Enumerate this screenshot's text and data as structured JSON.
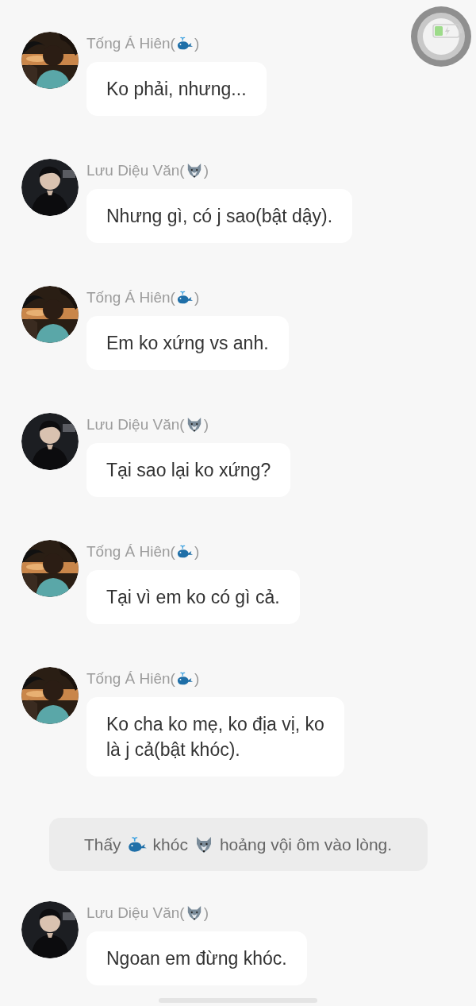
{
  "messages": [
    {
      "kind": "chat",
      "name_parts": [
        {
          "kind": "text",
          "text": "Tống Á Hiên("
        },
        {
          "kind": "whale"
        },
        {
          "kind": "text",
          "text": ")"
        }
      ],
      "text": "Ko phải, nhưng..."
    },
    {
      "kind": "chat",
      "name_parts": [
        {
          "kind": "text",
          "text": "Lưu Diệu Văn("
        },
        {
          "kind": "wolf"
        },
        {
          "kind": "text",
          "text": ")"
        }
      ],
      "text": "Nhưng gì, có j sao(bật dậy)."
    },
    {
      "kind": "chat",
      "name_parts": [
        {
          "kind": "text",
          "text": "Tống Á Hiên("
        },
        {
          "kind": "whale"
        },
        {
          "kind": "text",
          "text": ")"
        }
      ],
      "text": "Em ko xứng vs anh."
    },
    {
      "kind": "chat",
      "name_parts": [
        {
          "kind": "text",
          "text": "Lưu Diệu Văn("
        },
        {
          "kind": "wolf"
        },
        {
          "kind": "text",
          "text": ")"
        }
      ],
      "text": "Tại sao lại ko xứng?"
    },
    {
      "kind": "chat",
      "name_parts": [
        {
          "kind": "text",
          "text": "Tống Á Hiên("
        },
        {
          "kind": "whale"
        },
        {
          "kind": "text",
          "text": ")"
        }
      ],
      "text": "Tại vì em ko có gì cả."
    },
    {
      "kind": "chat",
      "name_parts": [
        {
          "kind": "text",
          "text": "Tống Á Hiên("
        },
        {
          "kind": "whale"
        },
        {
          "kind": "text",
          "text": ")"
        }
      ],
      "text": "Ko cha ko mẹ, ko địa vị, ko\nlà j cả(bật khóc)."
    },
    {
      "kind": "narration",
      "parts": [
        {
          "kind": "text",
          "text": "Thấy"
        },
        {
          "kind": "whale"
        },
        {
          "kind": "text",
          "text": "khóc"
        },
        {
          "kind": "wolf"
        },
        {
          "kind": "text",
          "text": "hoảng vội ôm vào lòng."
        }
      ]
    },
    {
      "kind": "chat",
      "name_parts": [
        {
          "kind": "text",
          "text": "Lưu Diệu Văn("
        },
        {
          "kind": "wolf"
        },
        {
          "kind": "text",
          "text": ")"
        }
      ],
      "text": "Ngoan em đừng khóc."
    }
  ]
}
